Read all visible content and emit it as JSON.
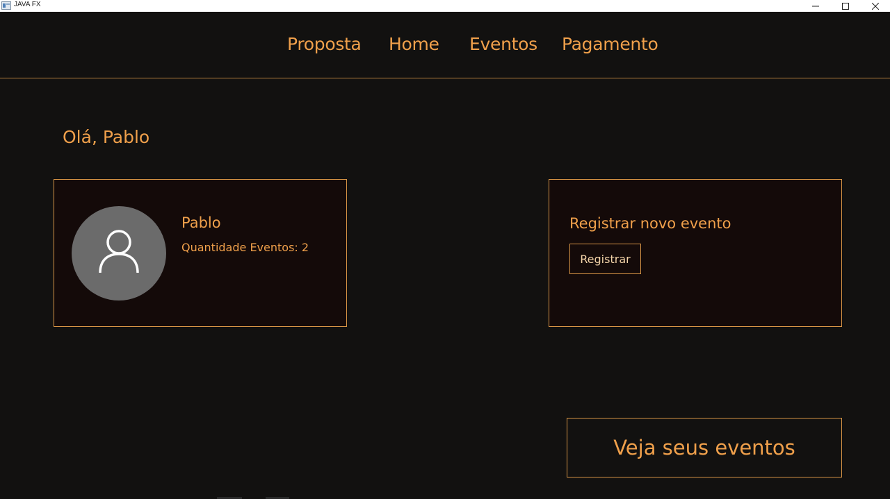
{
  "window": {
    "title": "JAVA FX",
    "controls": {
      "minimize_icon": "minimize-icon",
      "maximize_icon": "maximize-icon",
      "close_icon": "close-icon"
    }
  },
  "nav": {
    "items": [
      {
        "label": "Proposta"
      },
      {
        "label": "Home"
      },
      {
        "label": "Eventos"
      },
      {
        "label": "Pagamento"
      }
    ]
  },
  "greeting": "Olá, Pablo",
  "profile": {
    "name": "Pablo",
    "event_count_label": "Quantidade Eventos: 2",
    "avatar_icon": "user-icon"
  },
  "register": {
    "title": "Registrar novo evento",
    "button_label": "Registrar"
  },
  "events_button_label": "Veja seus eventos",
  "colors": {
    "background": "#121110",
    "accent": "#f0a04b",
    "card_background": "#140a09",
    "border": "#d89546",
    "avatar": "#6b6b6b"
  }
}
